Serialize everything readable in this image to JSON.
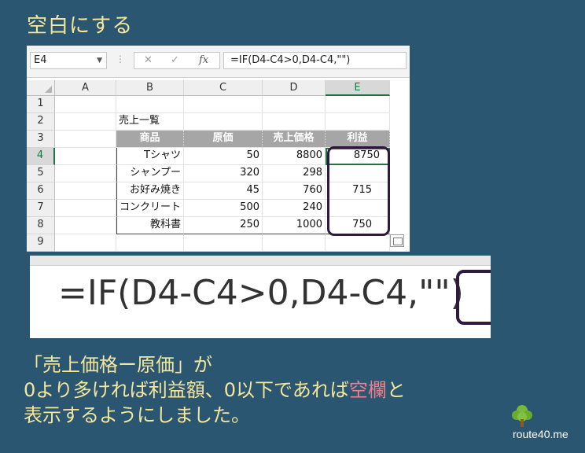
{
  "title": "空白にする",
  "excel": {
    "name_box": "E4",
    "formula": "=IF(D4-C4>0,D4-C4,\"\")",
    "fx_label": "fx",
    "columns": [
      "A",
      "B",
      "C",
      "D",
      "E"
    ],
    "rows": [
      "1",
      "2",
      "3",
      "4",
      "5",
      "6",
      "7",
      "8",
      "9"
    ],
    "sheet_title": "売上一覧",
    "table_headers": [
      "商品",
      "原価",
      "売上価格",
      "利益"
    ],
    "table_rows": [
      {
        "product": "Tシャツ",
        "cost": "50",
        "price": "8800",
        "profit": "8750"
      },
      {
        "product": "シャンプー",
        "cost": "320",
        "price": "298",
        "profit": ""
      },
      {
        "product": "お好み焼き",
        "cost": "45",
        "price": "760",
        "profit": "715"
      },
      {
        "product": "コンクリート",
        "cost": "500",
        "price": "240",
        "profit": ""
      },
      {
        "product": "教科書",
        "cost": "250",
        "price": "1000",
        "profit": "750"
      }
    ]
  },
  "zoom_formula": "=IF(D4-C4>0,D4-C4,\"\")",
  "caption": {
    "line1": "「売上価格ー原価」が",
    "line2_a": "0より多ければ利益額、0以下であれば",
    "line2_red": "空欄",
    "line2_b": "と",
    "line3": "表示するようにしました。"
  },
  "brand": "route40.me",
  "colors": {
    "background": "#2b5672",
    "title": "#f5e79a",
    "accent_red": "#f07f8e",
    "callout": "#2d1a3e",
    "excel_green": "#217346"
  }
}
